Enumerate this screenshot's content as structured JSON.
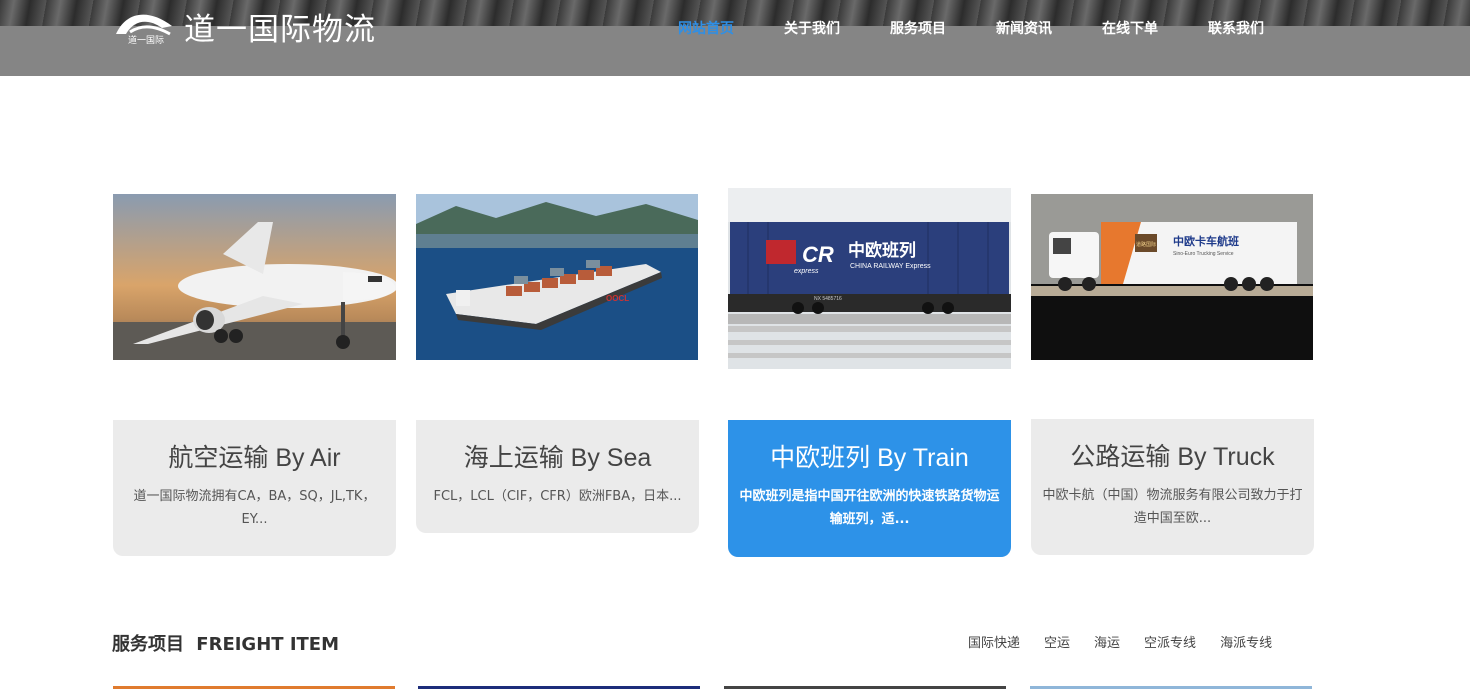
{
  "header": {
    "logo_text": "道一国际物流",
    "logo_sub": "道一国际",
    "nav": [
      "网站首页",
      "关于我们",
      "服务项目",
      "新闻资讯",
      "在线下单",
      "联系我们"
    ],
    "active_index": 0,
    "active_color": "#2f8fe5"
  },
  "services": [
    {
      "title": "航空运输 By Air",
      "desc": "道一国际物流拥有CA，BA，SQ，JL,TK，EY...",
      "active": false
    },
    {
      "title": "海上运输 By Sea",
      "desc": "FCL，LCL（CIF，CFR）欧洲FBA，日本...",
      "active": false
    },
    {
      "title": "中欧班列 By Train",
      "desc": "中欧班列是指中国开往欧洲的快速铁路货物运输班列，适...",
      "active": true
    },
    {
      "title": "公路运输 By Truck",
      "desc": "中欧卡航（中国）物流服务有限公司致力于打造中国至欧...",
      "active": false
    }
  ],
  "train_sign": {
    "brand": "CR",
    "cn": "中欧班列",
    "express": "express",
    "en": "CHINA RAILWAY Express",
    "car_no": "NX 5485716"
  },
  "truck_sign": {
    "cn": "中欧卡车航班",
    "en": "Sino-Euro Trucking Service",
    "badge": "道路国际"
  },
  "ship_sign": "OOCL",
  "section": {
    "title_cn": "服务项目",
    "title_en": "FREIGHT ITEM",
    "tabs": [
      "国际快递",
      "空运",
      "海运",
      "空派专线",
      "海派专线"
    ]
  },
  "colors": {
    "accent": "#2d92e8",
    "card_bg": "#ebebeb"
  }
}
